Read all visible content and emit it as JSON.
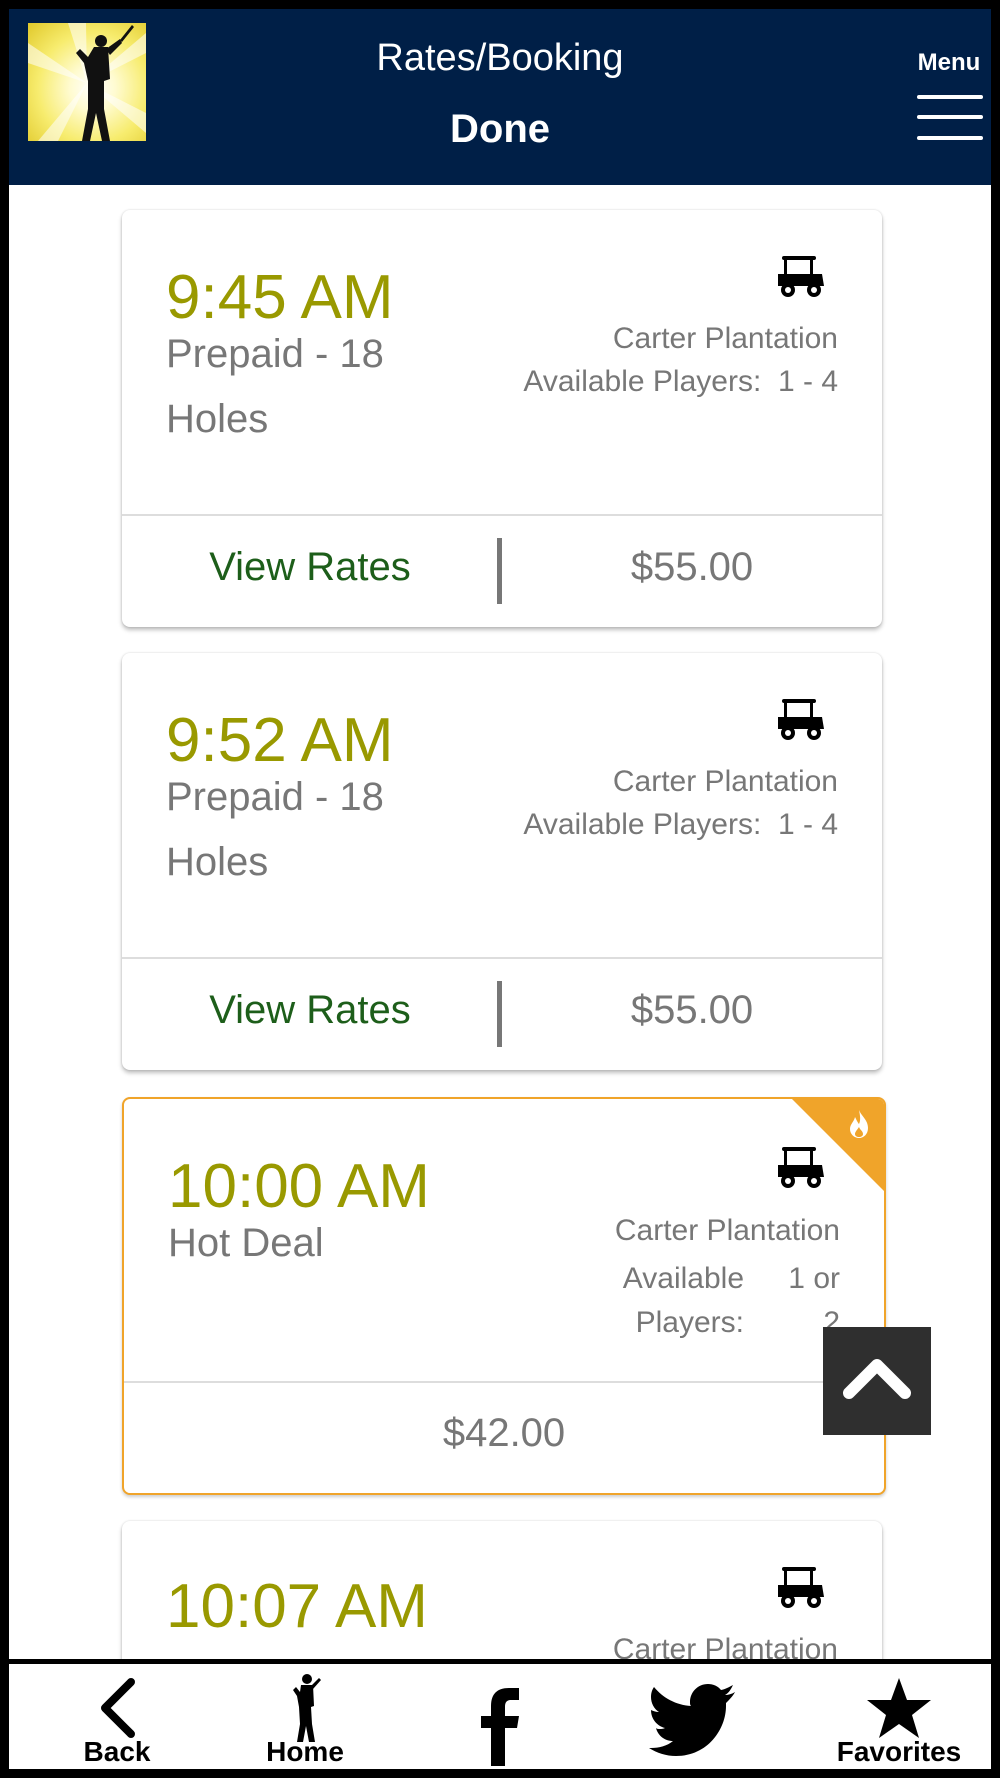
{
  "header": {
    "title": "Rates/Booking",
    "done_label": "Done",
    "menu_label": "Menu"
  },
  "tee_times": [
    {
      "time": "9:45 AM",
      "rate_name": "Prepaid - 18 Holes",
      "course": "Carter Plantation",
      "players_label": "Available Players:",
      "players_value": "1 - 4",
      "view_rates_label": "View Rates",
      "price": "$55.00"
    },
    {
      "time": "9:52 AM",
      "rate_name": "Prepaid - 18 Holes",
      "course": "Carter Plantation",
      "players_label": "Available Players:",
      "players_value": "1 - 4",
      "view_rates_label": "View Rates",
      "price": "$55.00"
    },
    {
      "time": "10:00 AM",
      "rate_name": "Hot Deal",
      "course": "Carter Plantation",
      "players_label_line1": "Available",
      "players_label_line2": "Players:",
      "players_value_line1": "1 or",
      "players_value_line2": "2",
      "price": "$42.00",
      "hot_deal": true
    },
    {
      "time": "10:07 AM",
      "course": "Carter Plantation"
    }
  ],
  "bottom_nav": {
    "back_label": "Back",
    "home_label": "Home",
    "favorites_label": "Favorites"
  },
  "colors": {
    "header_bg": "#001f47",
    "time_color": "#999900",
    "view_rates_color": "#1d5e1a",
    "hot_deal_accent": "#f0a42a"
  },
  "icons": [
    "golfer-logo-icon",
    "menu-icon",
    "golf-cart-icon",
    "flame-icon",
    "chevron-up-icon",
    "back-chevron-icon",
    "golfer-home-icon",
    "facebook-icon",
    "twitter-icon",
    "star-icon"
  ]
}
